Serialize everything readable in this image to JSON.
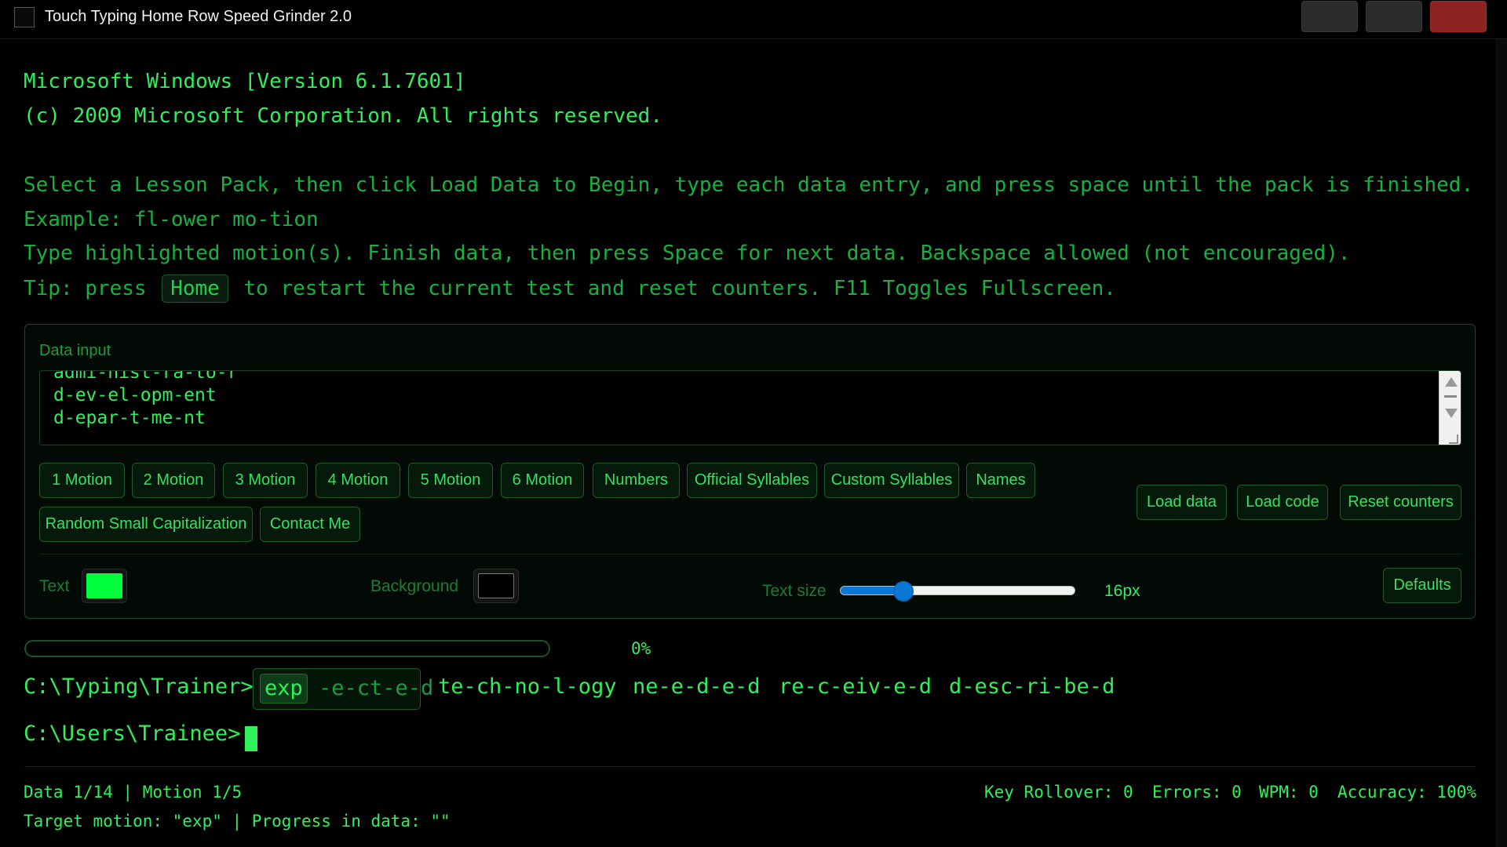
{
  "window": {
    "title": "Touch Typing Home Row Speed Grinder 2.0"
  },
  "console": {
    "line1": "Microsoft Windows [Version 6.1.7601]",
    "line2": "(c) 2009 Microsoft Corporation. All rights reserved.",
    "instructions": {
      "select": "Select a Lesson Pack, then click Load Data to Begin, type each data entry, and press space until the pack is finished.",
      "example": "Example: fl-ower mo-tion",
      "type": "Type highlighted motion(s). Finish data, then press Space for next data. Backspace allowed (not encouraged).",
      "tip_prefix": "Tip: press",
      "tip_key": "Home",
      "tip_suffix": "to restart the current test and reset counters. F11 Toggles Fullscreen."
    }
  },
  "panel": {
    "data_input_label": "Data input",
    "data_input_lines": [
      "admi-nist-ra-to-r",
      "d-ev-el-opm-ent",
      "d-epar-t-me-nt"
    ],
    "lesson_buttons": [
      "1 Motion",
      "2 Motion",
      "3 Motion",
      "4 Motion",
      "5 Motion",
      "6 Motion",
      "Numbers",
      "Official Syllables",
      "Custom Syllables",
      "Names",
      "Random Small Capitalization",
      "Contact Me"
    ],
    "action_buttons": {
      "load_data": "Load data",
      "load_code": "Load code",
      "reset_counters": "Reset counters"
    },
    "text_color_label": "Text",
    "text_color": "#00ff3b",
    "background_color_label": "Background",
    "background_color": "#000000",
    "text_size_label": "Text size",
    "text_size_value": "16px",
    "text_size_fraction": 0.27,
    "defaults_button": "Defaults"
  },
  "progress": {
    "percent_label": "0%",
    "fraction": 0
  },
  "trainer": {
    "prompt": "C:\\Typing\\Trainer>",
    "current_word_highlight": "exp",
    "current_word_rest": "-e-ct-e-d",
    "upcoming_words": [
      "te-ch-no-l-ogy",
      "ne-e-d-e-d",
      "re-c-eiv-e-d",
      "d-esc-ri-be-d"
    ],
    "input_prompt": "C:\\Users\\Trainee>"
  },
  "status": {
    "data_motion": "Data 1/14 | Motion 1/5",
    "target": "Target motion: \"exp\" | Progress in data: \"\"",
    "key_rollover": "Key Rollover: 0",
    "errors": "Errors: 0",
    "wpm": "WPM: 0",
    "accuracy": "Accuracy: 100%"
  },
  "colors": {
    "accent": "#2ff05a",
    "dim": "#16b23f",
    "close_button": "#8e2323",
    "slider": "#0a78d4"
  }
}
